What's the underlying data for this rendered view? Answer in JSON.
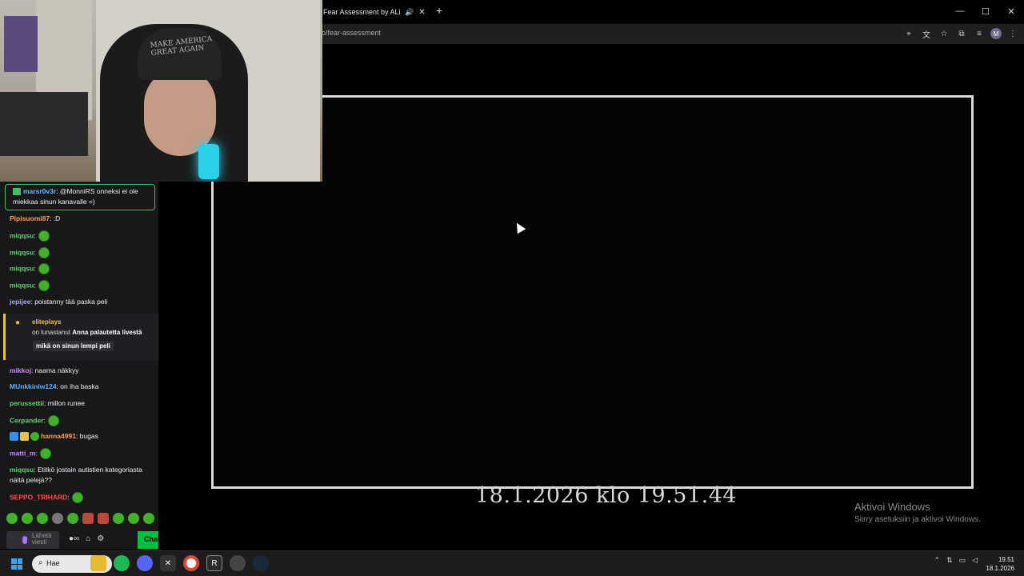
{
  "browser": {
    "tab_title": "Fear Assessment by ALEXA",
    "url": "o/fear-assessment",
    "avatar_letter": "M"
  },
  "webcam": {
    "cap_text": "MAKE AMERICA GREAT AGAIN"
  },
  "game": {
    "timestamp": "18.1.2026 klo 19.51.44"
  },
  "windows_activation": {
    "title": "Aktivoi Windows",
    "subtitle": "Siirry asetuksiin ja aktivoi Windows."
  },
  "chat": {
    "messages": [
      {
        "user": "marsr0v3r",
        "text": ": @MonniRS onneksi ei ole miekkaa sinun kanavalle =)",
        "color": "#6bb8ff",
        "emote": false
      },
      {
        "user": "Pipisuomi87",
        "text": ": :D",
        "color": "#ff9f4a",
        "emote": false
      },
      {
        "user": "miqqsu",
        "text": ":",
        "color": "#62d36e",
        "emote": true
      },
      {
        "user": "miqqsu",
        "text": ":",
        "color": "#62d36e",
        "emote": true
      },
      {
        "user": "miqqsu",
        "text": ":",
        "color": "#62d36e",
        "emote": true
      },
      {
        "user": "miqqsu",
        "text": ":",
        "color": "#62d36e",
        "emote": true
      },
      {
        "user": "jepijee",
        "text": ": poistanny tää paska peli",
        "color": "#9ab4ff",
        "emote": false
      },
      {
        "user": "mikkoj",
        "text": ": naama näkkyy",
        "color": "#c98cff",
        "emote": false
      },
      {
        "user": "MUnkkiniw124",
        "text": ": on iha baska",
        "color": "#5ab0ff",
        "emote": false
      },
      {
        "user": "perussettii",
        "text": ": millon runee",
        "color": "#62d36e",
        "emote": false
      },
      {
        "user": "Cerpander",
        "text": ":",
        "color": "#62d36e",
        "emote": true
      },
      {
        "user": "hanna4991",
        "text": ": bugas",
        "color": "#ff9f4a",
        "emote": false
      },
      {
        "user": "matti_m",
        "text": ":",
        "color": "#c98cff",
        "emote": true
      },
      {
        "user": "miqqsu",
        "text": ": Etitkö jostain autistien kategoriasta näitä pelejä??",
        "color": "#62d36e",
        "emote": false
      },
      {
        "user": "SEPPO_TRIHARD",
        "text": ":",
        "color": "#ff4a4a",
        "emote": true
      }
    ],
    "redemption": {
      "user": "eliteplays",
      "prefix": "on lunastanut",
      "reward": "Anna palautetta livestä",
      "message": "mikä on sinun lempi peli"
    },
    "input_placeholder": "Lähetä viesti",
    "send_label": "Chat"
  },
  "taskbar": {
    "search_label": "Hae",
    "time": "19.51",
    "date": "18.1.2026"
  }
}
